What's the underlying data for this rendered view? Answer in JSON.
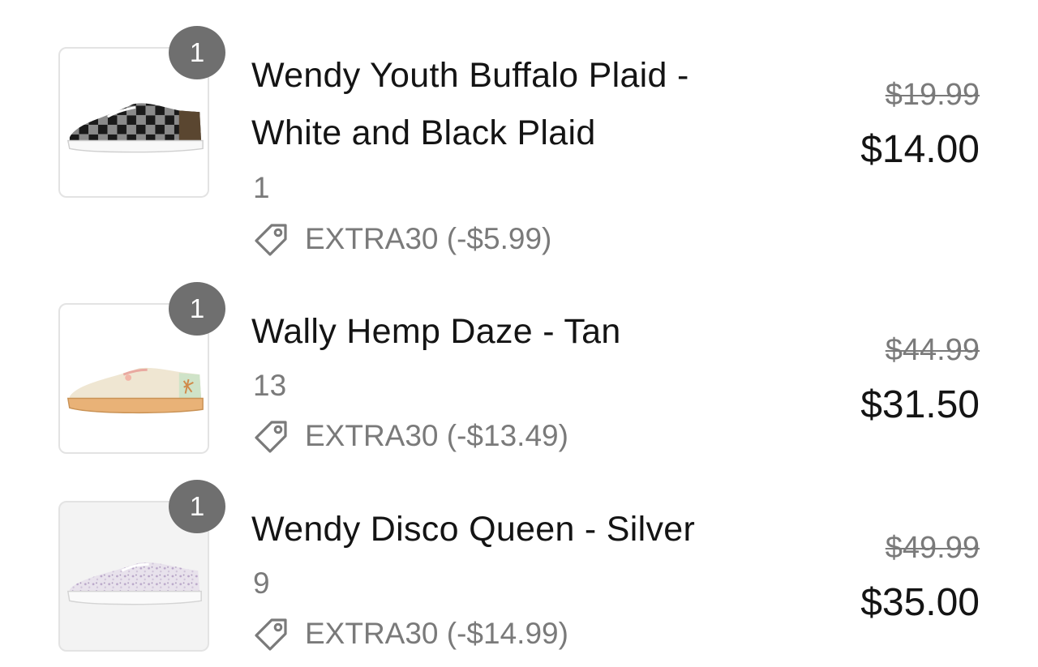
{
  "cart": {
    "items": [
      {
        "quantity": "1",
        "title_line1": "Wendy Youth Buffalo Plaid -",
        "title_line2": "White and Black Plaid",
        "variant": "1",
        "discount": "EXTRA30 (-$5.99)",
        "original_price": "$19.99",
        "sale_price": "$14.00",
        "image": "buffalo-plaid-shoe-image"
      },
      {
        "quantity": "1",
        "title_line1": "Wally Hemp Daze - Tan",
        "variant": "13",
        "discount": "EXTRA30 (-$13.49)",
        "original_price": "$44.99",
        "sale_price": "$31.50",
        "image": "tan-hemp-shoe-image"
      },
      {
        "quantity": "1",
        "title_line1": "Wendy Disco Queen - Silver",
        "variant": "9",
        "discount": "EXTRA30 (-$14.99)",
        "original_price": "$49.99",
        "sale_price": "$35.00",
        "image": "silver-glitter-shoe-image"
      }
    ],
    "icons": {
      "discount": "tag-icon"
    },
    "colors": {
      "badge": "#6f6f6f",
      "muted_text": "#7a7a7a",
      "primary_text": "#141414"
    }
  }
}
